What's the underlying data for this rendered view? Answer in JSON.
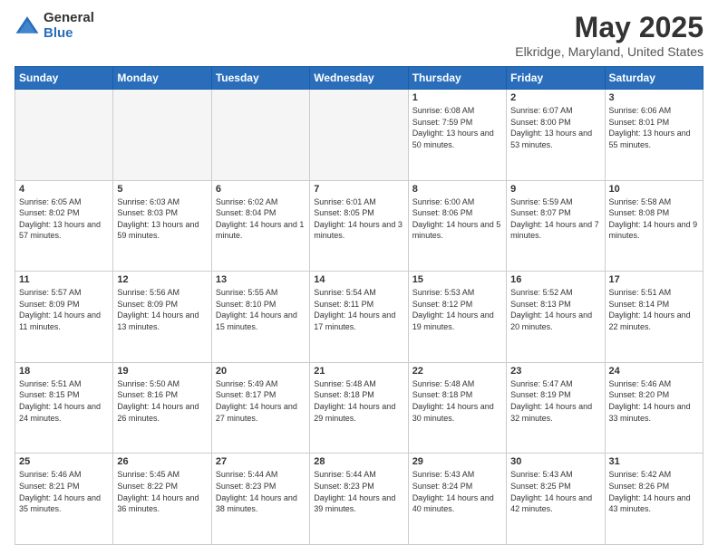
{
  "logo": {
    "general": "General",
    "blue": "Blue"
  },
  "header": {
    "title": "May 2025",
    "subtitle": "Elkridge, Maryland, United States"
  },
  "weekdays": [
    "Sunday",
    "Monday",
    "Tuesday",
    "Wednesday",
    "Thursday",
    "Friday",
    "Saturday"
  ],
  "weeks": [
    [
      {
        "day": "",
        "empty": true
      },
      {
        "day": "",
        "empty": true
      },
      {
        "day": "",
        "empty": true
      },
      {
        "day": "",
        "empty": true
      },
      {
        "day": "1",
        "sunrise": "6:08 AM",
        "sunset": "7:59 PM",
        "daylight": "13 hours and 50 minutes."
      },
      {
        "day": "2",
        "sunrise": "6:07 AM",
        "sunset": "8:00 PM",
        "daylight": "13 hours and 53 minutes."
      },
      {
        "day": "3",
        "sunrise": "6:06 AM",
        "sunset": "8:01 PM",
        "daylight": "13 hours and 55 minutes."
      }
    ],
    [
      {
        "day": "4",
        "sunrise": "6:05 AM",
        "sunset": "8:02 PM",
        "daylight": "13 hours and 57 minutes."
      },
      {
        "day": "5",
        "sunrise": "6:03 AM",
        "sunset": "8:03 PM",
        "daylight": "13 hours and 59 minutes."
      },
      {
        "day": "6",
        "sunrise": "6:02 AM",
        "sunset": "8:04 PM",
        "daylight": "14 hours and 1 minute."
      },
      {
        "day": "7",
        "sunrise": "6:01 AM",
        "sunset": "8:05 PM",
        "daylight": "14 hours and 3 minutes."
      },
      {
        "day": "8",
        "sunrise": "6:00 AM",
        "sunset": "8:06 PM",
        "daylight": "14 hours and 5 minutes."
      },
      {
        "day": "9",
        "sunrise": "5:59 AM",
        "sunset": "8:07 PM",
        "daylight": "14 hours and 7 minutes."
      },
      {
        "day": "10",
        "sunrise": "5:58 AM",
        "sunset": "8:08 PM",
        "daylight": "14 hours and 9 minutes."
      }
    ],
    [
      {
        "day": "11",
        "sunrise": "5:57 AM",
        "sunset": "8:09 PM",
        "daylight": "14 hours and 11 minutes."
      },
      {
        "day": "12",
        "sunrise": "5:56 AM",
        "sunset": "8:09 PM",
        "daylight": "14 hours and 13 minutes."
      },
      {
        "day": "13",
        "sunrise": "5:55 AM",
        "sunset": "8:10 PM",
        "daylight": "14 hours and 15 minutes."
      },
      {
        "day": "14",
        "sunrise": "5:54 AM",
        "sunset": "8:11 PM",
        "daylight": "14 hours and 17 minutes."
      },
      {
        "day": "15",
        "sunrise": "5:53 AM",
        "sunset": "8:12 PM",
        "daylight": "14 hours and 19 minutes."
      },
      {
        "day": "16",
        "sunrise": "5:52 AM",
        "sunset": "8:13 PM",
        "daylight": "14 hours and 20 minutes."
      },
      {
        "day": "17",
        "sunrise": "5:51 AM",
        "sunset": "8:14 PM",
        "daylight": "14 hours and 22 minutes."
      }
    ],
    [
      {
        "day": "18",
        "sunrise": "5:51 AM",
        "sunset": "8:15 PM",
        "daylight": "14 hours and 24 minutes."
      },
      {
        "day": "19",
        "sunrise": "5:50 AM",
        "sunset": "8:16 PM",
        "daylight": "14 hours and 26 minutes."
      },
      {
        "day": "20",
        "sunrise": "5:49 AM",
        "sunset": "8:17 PM",
        "daylight": "14 hours and 27 minutes."
      },
      {
        "day": "21",
        "sunrise": "5:48 AM",
        "sunset": "8:18 PM",
        "daylight": "14 hours and 29 minutes."
      },
      {
        "day": "22",
        "sunrise": "5:48 AM",
        "sunset": "8:18 PM",
        "daylight": "14 hours and 30 minutes."
      },
      {
        "day": "23",
        "sunrise": "5:47 AM",
        "sunset": "8:19 PM",
        "daylight": "14 hours and 32 minutes."
      },
      {
        "day": "24",
        "sunrise": "5:46 AM",
        "sunset": "8:20 PM",
        "daylight": "14 hours and 33 minutes."
      }
    ],
    [
      {
        "day": "25",
        "sunrise": "5:46 AM",
        "sunset": "8:21 PM",
        "daylight": "14 hours and 35 minutes."
      },
      {
        "day": "26",
        "sunrise": "5:45 AM",
        "sunset": "8:22 PM",
        "daylight": "14 hours and 36 minutes."
      },
      {
        "day": "27",
        "sunrise": "5:44 AM",
        "sunset": "8:23 PM",
        "daylight": "14 hours and 38 minutes."
      },
      {
        "day": "28",
        "sunrise": "5:44 AM",
        "sunset": "8:23 PM",
        "daylight": "14 hours and 39 minutes."
      },
      {
        "day": "29",
        "sunrise": "5:43 AM",
        "sunset": "8:24 PM",
        "daylight": "14 hours and 40 minutes."
      },
      {
        "day": "30",
        "sunrise": "5:43 AM",
        "sunset": "8:25 PM",
        "daylight": "14 hours and 42 minutes."
      },
      {
        "day": "31",
        "sunrise": "5:42 AM",
        "sunset": "8:26 PM",
        "daylight": "14 hours and 43 minutes."
      }
    ]
  ]
}
